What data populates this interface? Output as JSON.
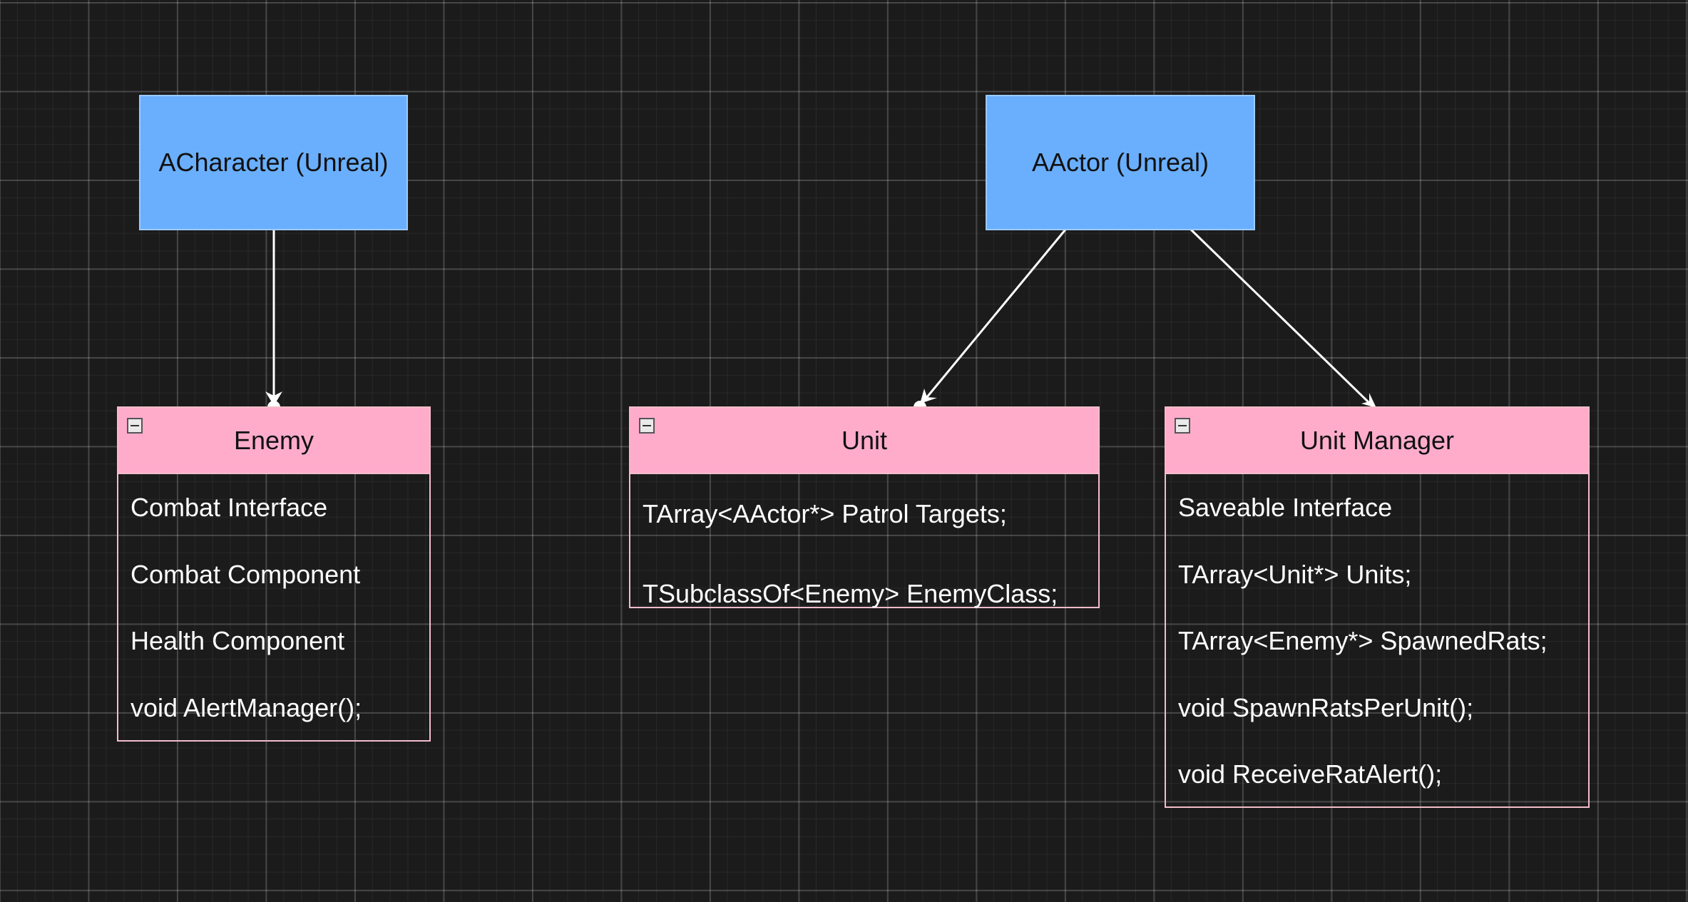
{
  "diagram": {
    "nodes": {
      "acharacter": {
        "label": "ACharacter (Unreal)"
      },
      "aactor": {
        "label": "AActor (Unreal)"
      }
    },
    "classes": {
      "enemy": {
        "title": "Enemy",
        "members": [
          "Combat Interface",
          "Combat Component",
          "Health Component",
          "void AlertManager();"
        ]
      },
      "unit": {
        "title": "Unit",
        "members": [
          "TArray<AActor*> Patrol Targets;",
          "TSubclassOf<Enemy> EnemyClass;"
        ]
      },
      "unit_manager": {
        "title": "Unit Manager",
        "members": [
          "Saveable Interface",
          "TArray<Unit*> Units;",
          "TArray<Enemy*> SpawnedRats;",
          "void SpawnRatsPerUnit();",
          "void ReceiveRatAlert();"
        ]
      }
    },
    "edges": [
      {
        "from": "ACharacter (Unreal)",
        "to": "Enemy"
      },
      {
        "from": "AActor (Unreal)",
        "to": "Unit"
      },
      {
        "from": "AActor (Unreal)",
        "to": "Unit Manager"
      }
    ],
    "colors": {
      "background": "#1b1b1c",
      "grid": "#3a3a3a",
      "node_fill": "#6aaffd",
      "class_header_fill": "#ffaccb",
      "class_border": "#f3bcc9",
      "edge": "#ffffff"
    }
  }
}
